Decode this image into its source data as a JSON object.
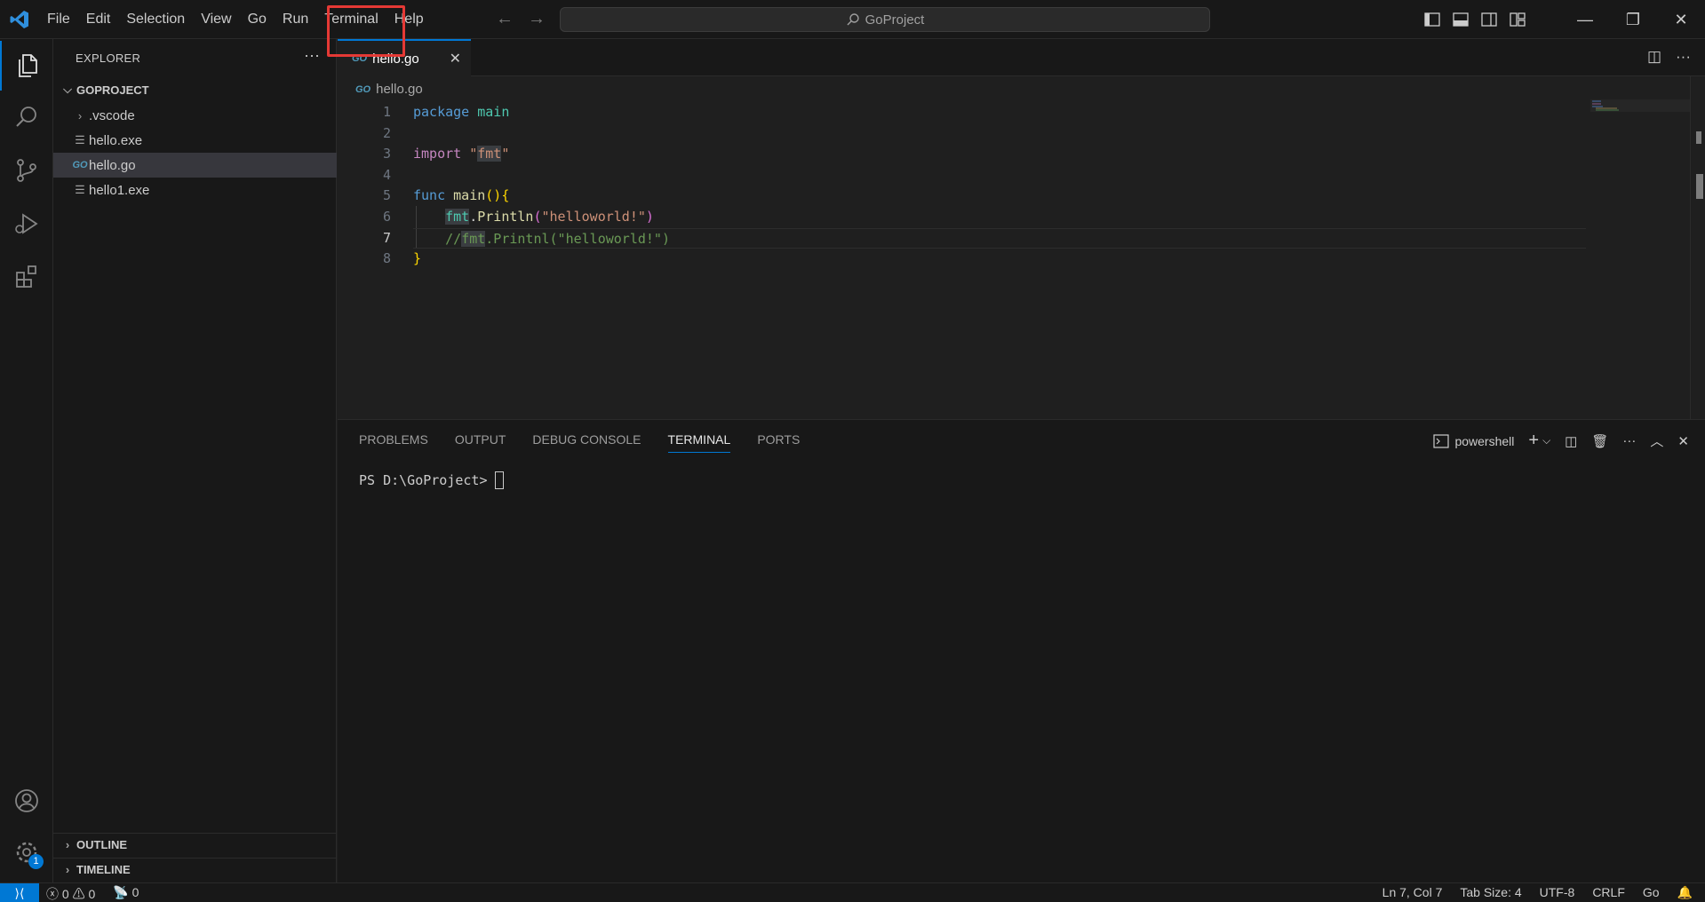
{
  "menu": [
    "File",
    "Edit",
    "Selection",
    "View",
    "Go",
    "Run",
    "Terminal",
    "Help"
  ],
  "command_center": {
    "text": "GoProject"
  },
  "sidebar": {
    "title": "EXPLORER",
    "more": "···",
    "folder": "GOPROJECT",
    "items": [
      {
        "label": ".vscode",
        "icon": "chevron-right"
      },
      {
        "label": "hello.exe",
        "icon": "lines"
      },
      {
        "label": "hello.go",
        "icon": "go"
      },
      {
        "label": "hello1.exe",
        "icon": "lines"
      }
    ],
    "outline": "OUTLINE",
    "timeline": "TIMELINE"
  },
  "tab": {
    "label": "hello.go",
    "close": "✕"
  },
  "breadcrumb": {
    "file": "hello.go",
    "go_icon_text": "GO"
  },
  "editor": {
    "line_numbers": [
      "1",
      "2",
      "3",
      "4",
      "5",
      "6",
      "7",
      "8"
    ],
    "current_line": "7",
    "code": {
      "l1_kw": "package",
      "l1_name": "main",
      "l3_kw": "import",
      "l3_q1": "\"",
      "l3_pkg": "fmt",
      "l3_q2": "\"",
      "l5_kw": "func",
      "l5_fn": "main",
      "l5_paren": "()",
      "l5_brace": "{",
      "l6_pkg": "fmt",
      "l6_dot": ".",
      "l6_fn": "Println",
      "l6_p1": "(",
      "l6_str": "\"helloworld!\"",
      "l6_p2": ")",
      "l7_c1": "//",
      "l7_c2": "fmt",
      "l7_c3": ".Printnl(\"helloworld!\")",
      "l8_brace": "}"
    }
  },
  "panel": {
    "tabs": [
      "PROBLEMS",
      "OUTPUT",
      "DEBUG CONSOLE",
      "TERMINAL",
      "PORTS"
    ],
    "active_tab": "TERMINAL",
    "shell": "powershell",
    "prompt": "PS D:\\GoProject>"
  },
  "status": {
    "errors": "0",
    "warnings": "0",
    "ports": "0",
    "position": "Ln 7, Col 7",
    "tab_size": "Tab Size: 4",
    "encoding": "UTF-8",
    "eol": "CRLF",
    "language": "Go",
    "badge": "1"
  },
  "colors": {
    "accent": "#0078d4",
    "highlight_box": "#e53935",
    "background": "#1f1f1f",
    "chrome": "#181818"
  }
}
